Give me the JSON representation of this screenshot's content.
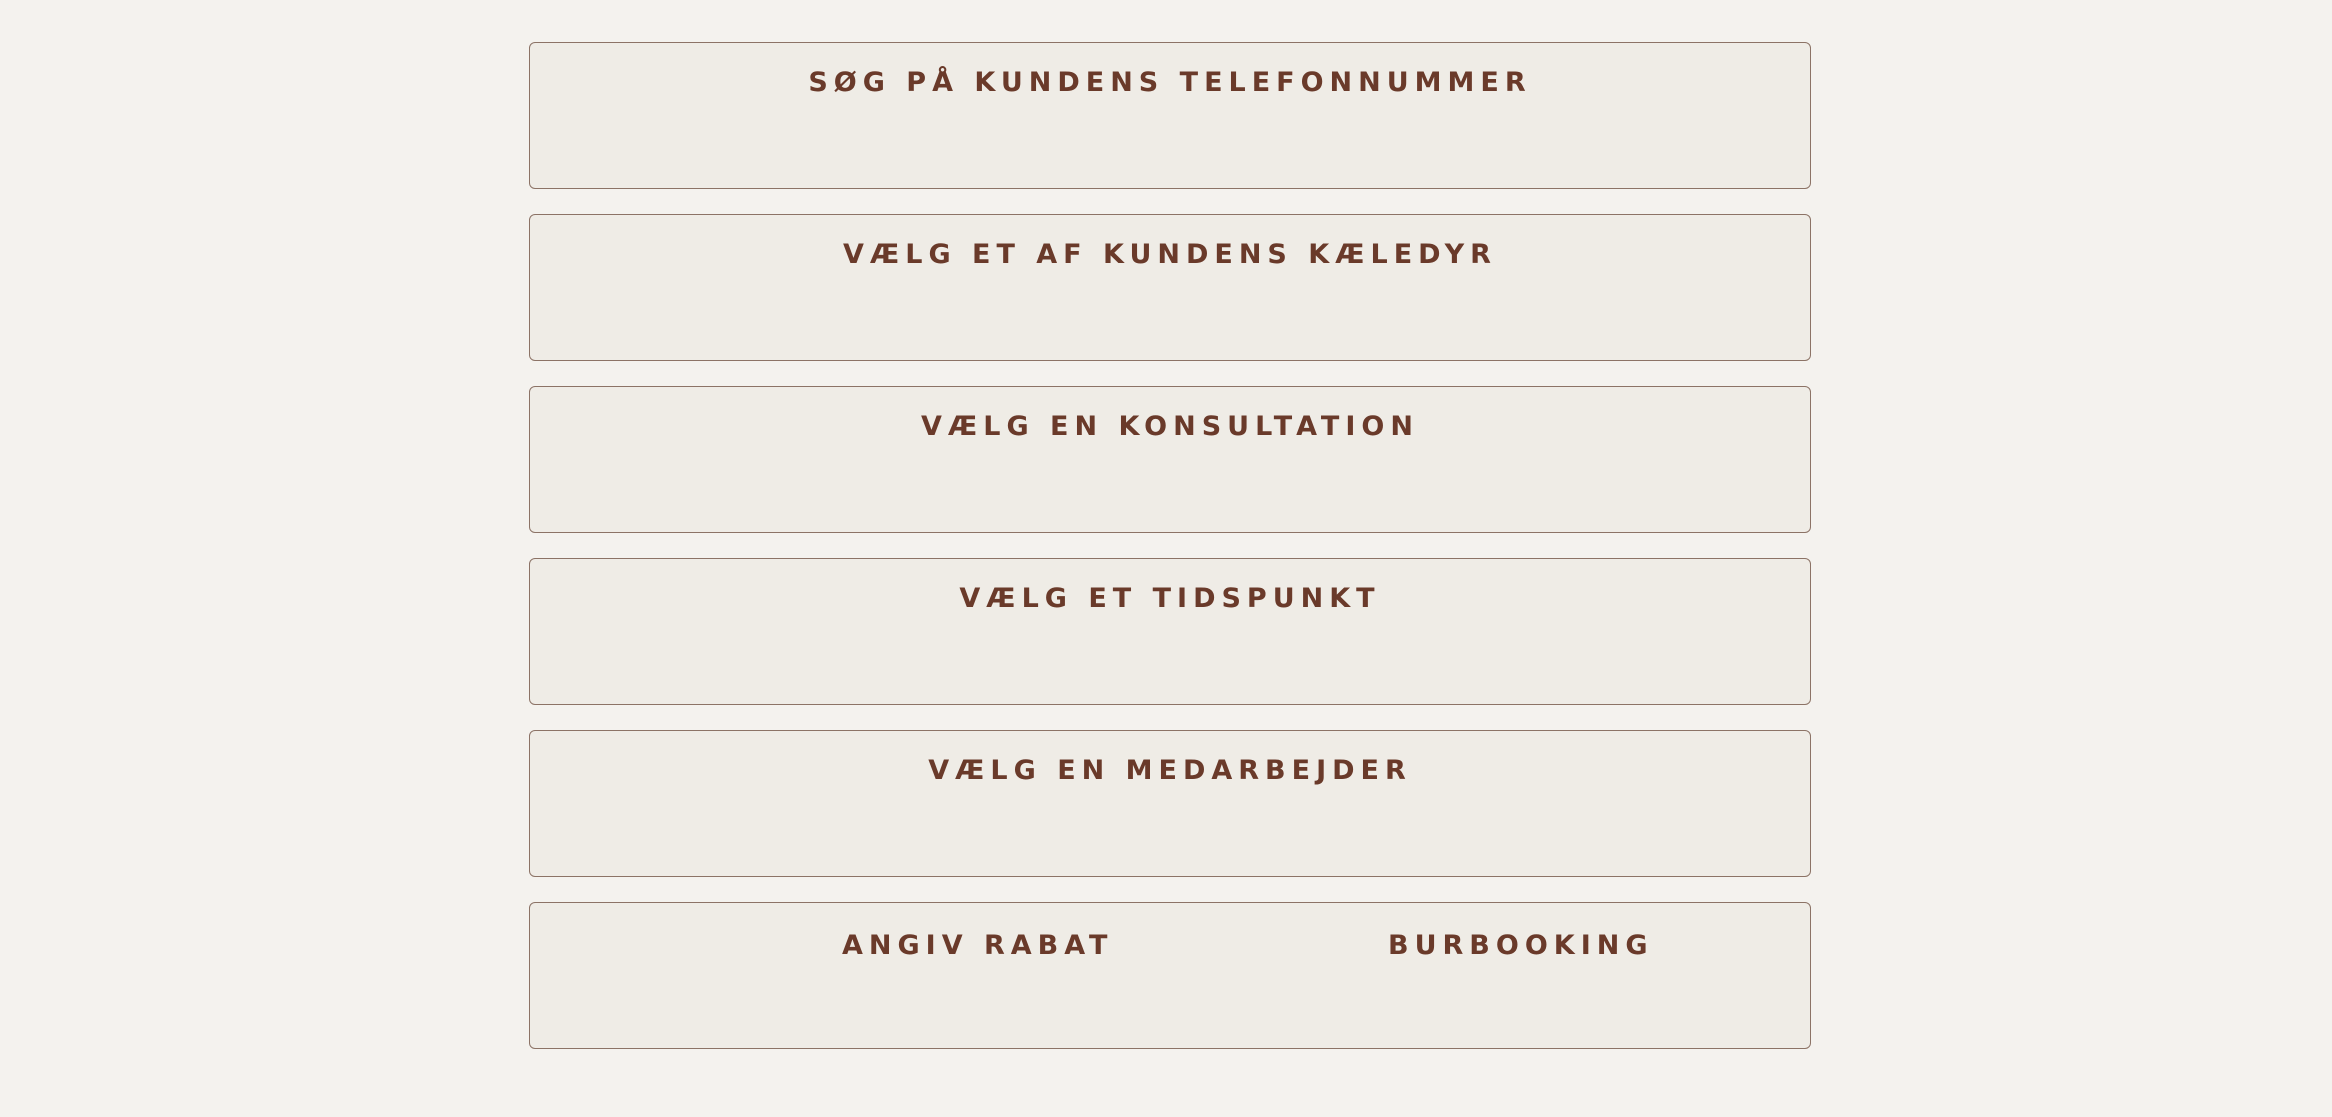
{
  "colors": {
    "page_background": "#f4f2ee",
    "panel_background": "#efece6",
    "panel_border": "#8c7366",
    "text": "#6a3a2a"
  },
  "steps": {
    "phone_search": {
      "title": "SØG PÅ KUNDENS TELEFONNUMMER"
    },
    "pet_select": {
      "title": "VÆLG ET AF KUNDENS KÆLEDYR"
    },
    "consultation_select": {
      "title": "VÆLG EN KONSULTATION"
    },
    "time_select": {
      "title": "VÆLG ET TIDSPUNKT"
    },
    "employee_select": {
      "title": "VÆLG EN MEDARBEJDER"
    },
    "discount": {
      "title": "ANGIV RABAT"
    },
    "cage_booking": {
      "title": "BURBOOKING"
    }
  }
}
